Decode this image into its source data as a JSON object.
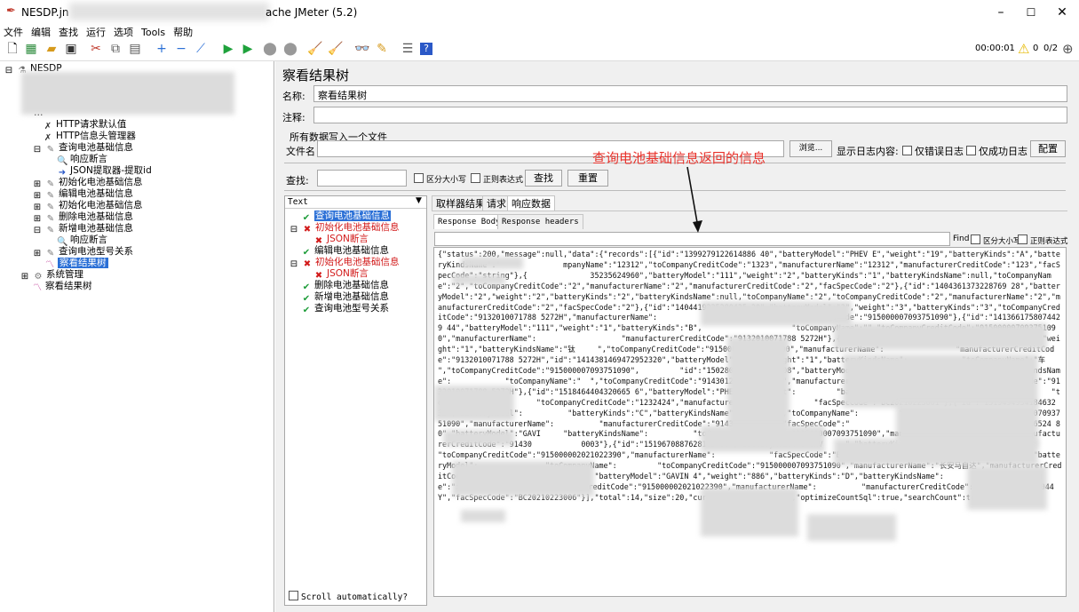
{
  "window": {
    "title_prefix": "NESDP.jn",
    "title_suffix": "ache JMeter (5.2)",
    "min": "–",
    "max": "☐",
    "close": "✕"
  },
  "menu": [
    "文件",
    "编辑",
    "查找",
    "运行",
    "选项",
    "Tools",
    "帮助"
  ],
  "toolbar": {
    "timer": "00:00:01",
    "warn_count": "0",
    "threads": "0/2"
  },
  "tree": {
    "root": "NESDP",
    "partial": "…",
    "items": [
      "HTTP请求默认值",
      "HTTP信息头管理器",
      "查询电池基础信息",
      "响应断言",
      "JSON提取器-提取id",
      "初始化电池基础信息",
      "编辑电池基础信息",
      "初始化电池基础信息",
      "删除电池基础信息",
      "新增电池基础信息",
      "响应断言",
      "查询电池型号关系",
      "察看结果树",
      "系统管理",
      "察看结果树"
    ]
  },
  "panel": {
    "title": "察看结果树",
    "name_label": "名称:",
    "name_value": "察看结果树",
    "comment_label": "注释:",
    "write_all": "所有数据写入一个文件",
    "filename_label": "文件名",
    "browse": "浏览...",
    "log_show": "显示日志内容:",
    "only_error": "仅错误日志",
    "only_success": "仅成功日志",
    "config": "配置",
    "search_label": "查找:",
    "case": "区分大小写",
    "regex": "正则表达式",
    "find_btn": "查找",
    "reset_btn": "重置"
  },
  "results": {
    "renderer": "Text",
    "items": [
      {
        "label": "查询电池基础信息",
        "status": "ok"
      },
      {
        "label": "初始化电池基础信息",
        "status": "fail"
      },
      {
        "label": "JSON断言",
        "status": "fail"
      },
      {
        "label": "编辑电池基础信息",
        "status": "ok"
      },
      {
        "label": "初始化电池基础信息",
        "status": "fail"
      },
      {
        "label": "JSON断言",
        "status": "fail"
      },
      {
        "label": "删除电池基础信息",
        "status": "ok"
      },
      {
        "label": "新增电池基础信息",
        "status": "ok"
      },
      {
        "label": "查询电池型号关系",
        "status": "ok"
      }
    ],
    "scroll_auto": "Scroll automatically?"
  },
  "tabs": {
    "sampler": "取样器结果",
    "request": "请求",
    "response": "响应数据"
  },
  "subtabs": {
    "body": "Response Body",
    "headers": "Response headers"
  },
  "find_row": {
    "find": "Find",
    "case": "区分大小写",
    "regex": "正则表达式"
  },
  "annotation": "查询电池基础信息返回的信息",
  "response_text": "{\"status\":200,\"message\":null,\"data\":{\"records\":[{\"id\":\"1399279122614886 40\",\"batteryModel\":\"PHEV E\",\"weight\":\"19\",\"batteryKinds\":\"A\",\"batteryKindsName\":\"              mpanyName\":\"12312\",\"toCompanyCreditCode\":\"1323\",\"manufacturerName\":\"12312\",\"manufacturerCreditCode\":\"123\",\"facSpecCode\":\"string\"},{              35235624960\",\"batteryModel\":\"111\",\"weight\":\"2\",\"batteryKinds\":\"1\",\"batteryKindsName\":null,\"toCompanyName\":\"2\",\"toCompanyCreditCode\":\"2\",\"manufacturerName\":\"2\",\"manufacturerCreditCode\":\"2\",\"facSpecCode\":\"2\"},{\"id\":\"1404361373228769 28\",\"batteryModel\":\"2\",\"weight\":\"2\",\"batteryKinds\":\"2\",\"batteryKindsName\":null,\"toCompanyName\":\"2\",\"toCompanyCreditCode\":\"2\",\"manufacturerName\":\"2\",\"manufacturerCreditCode\":\"2\",\"facSpecCode\":\"2\"},{\"id\":\"1404419335280435 20\",\"batteryModel\":\"3\",\"weight\":\"3\",\"batteryKinds\":\"3\",\"toCompanyCreditCode\":\"9132010071788 5272H\",\"manufacturerName\":                     \"manufacturerCreditCode\":\"915000007093751090\"},{\"id\":\"1413661758074429 44\",\"batteryModel\":\"111\",\"weight\":\"1\",\"batteryKinds\":\"B\",                    \"toCompanyName\":\"\",\"toCompanyCreditCode\":\"915000007093751090\",\"manufacturerName\":                   \"manufacturerCreditCode\":\"9132010071788 5272H\"},{\"id\":\"1414106729897984\",\"batteryModel\":\"222\",\"weight\":\"1\",\"batteryKindsName\":\"钛     \",\"toCompanyCreditCode\":\"915000007093751090\",\"manufacturerName\":                \"manufacturerCreditCode\":\"9132010071788 5272H\",\"id\":\"1414381469472952320\",\"batteryModel\":\"333\",\"weight\":\"1\",\"batteryKindsName\":            \"toCompanyName\":\"车  \",\"toCompanyCreditCode\":\"915000007093751090\",         \"id\":\"1502800211546974208\",\"batteryModel\":\"BEV A\",\"weight\":          \"batteryKindsName\":            \"toCompanyName\":\"  \",\"toCompanyCreditCode\":\"91430124670796044Y\",\"manufacturerName\":             \"manufacturerCreditCode\":\"9132010071788 5272H\"},{\"id\":\"1518464404320665 6\",\"batteryModel\":\"PHEV D\",\"weight\":         \"batteryKinds\":\"B\",\"batteryKindsName\":          \"toCompanyName\":        \"toCompanyCreditCode\":\"1232424\",\"manufacturerName\":           \"facSpecCode\":\"BC20210223001\"},{\"id\":\"1519494934184632 32\",\"batteryModel\":          \"batteryKinds\":\"C\",\"batteryKindsName\":\"        \",\"toCompanyName\":         \"toCompanyCreditCode\":\"915000007093751090\",\"manufacturerName\":          \"manufacturerCreditCode\":\"91430          \"facSpecCode\":\"                002\"},{\"id\":\"1519500178616524 80\",\"batteryModel\":\"GAVI     \"batteryKindsName\":          \"toCompanyCreditCode\":\"915000007093751090\",\"manufacturerName\":          \"manufacturerCreditCode\":\"91430           0003\"},{\"id\":\"1519670887628185 60\",\"batteryModel\":\"GAV     \",\"batteryKinds\":\"B\",\"batteryKi                \"toCompanyCreditCode\":\"915000002021022390\",\"manufacturerName\":            \"facSpecCode\":\"BC20210223005\"},{\"id\":\"1522313920324608 00\",\"batteryModel\":               \"toCompanyName\":         \"toCompanyCreditCode\":\"915000007093751090\",\"manufacturerName\":\"长安马自达\",\"manufacturerCreditCode\":\"9132010071788 5272H\",     \"batteryModel\":\"GAVIN 4\",\"weight\":\"886\",\"batteryKinds\":\"D\",\"batteryKindsName\":         \"toCompanyName\":\"北京精英开发有限公司\",\"toCompanyCreditCode\":\"915000002021022390\",\"manufacturerName\":          \"manufacturerCreditCode\":\"91430123456789044Y\",\"facSpecCode\":\"BC20210223006\"}],\"total\":14,\"size\":20,\"current\":1,\"orders\":[],\"optimizeCountSql\":true,\"searchCount\":true,\"pages\":1}}"
}
